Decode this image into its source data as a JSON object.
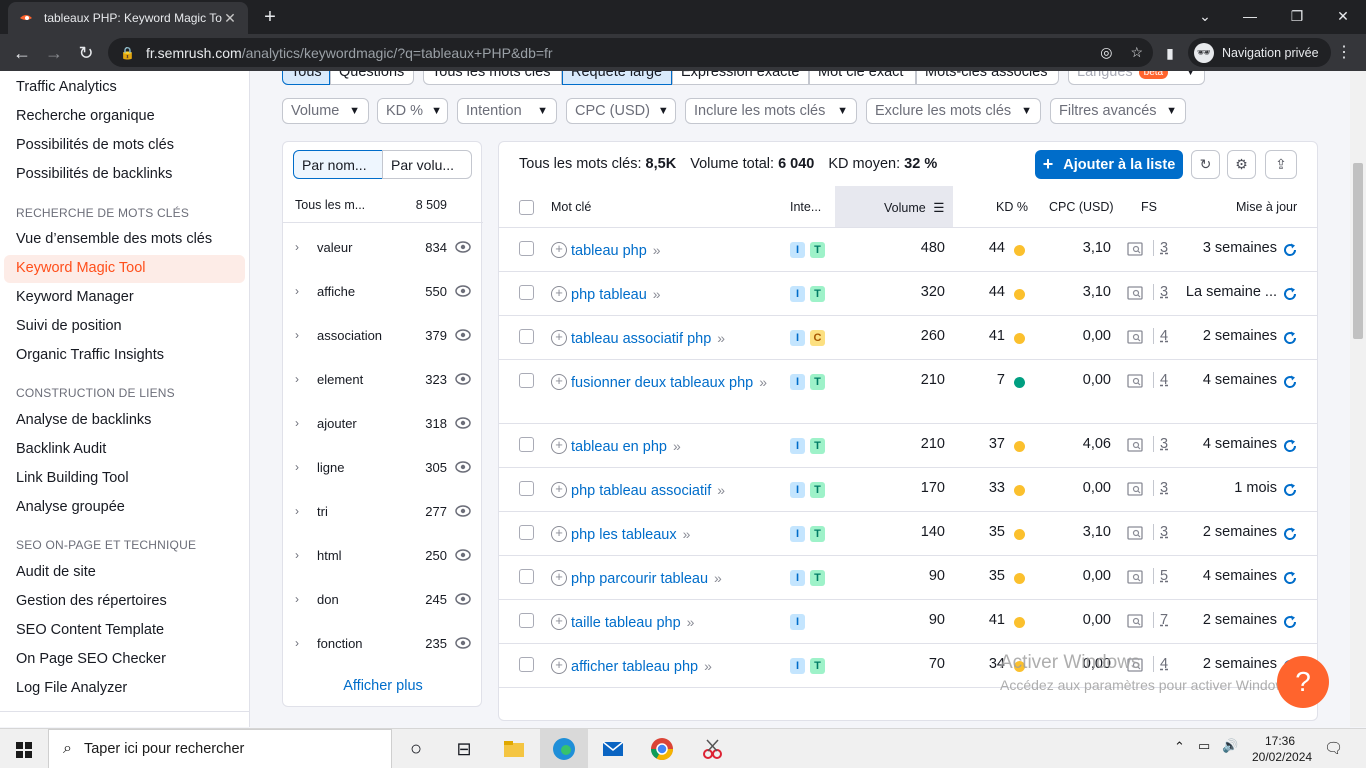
{
  "browser": {
    "tab_title": "tableaux PHP: Keyword Magic To",
    "url_host": "fr.semrush.com",
    "url_path": "/analytics/keywordmagic/?q=tableaux+PHP&db=fr",
    "incognito_label": "Navigation privée"
  },
  "sidebar": {
    "items_top": [
      "Traffic Analytics",
      "Recherche organique",
      "Possibilités de mots clés",
      "Possibilités de backlinks"
    ],
    "section1": "RECHERCHE DE MOTS CLÉS",
    "items1": [
      "Vue d’ensemble des mots clés",
      "Keyword Magic Tool",
      "Keyword Manager",
      "Suivi de position",
      "Organic Traffic Insights"
    ],
    "section2": "CONSTRUCTION DE LIENS",
    "items2": [
      "Analyse de backlinks",
      "Backlink Audit",
      "Link Building Tool",
      "Analyse groupée"
    ],
    "section3": "SEO ON-PAGE ET TECHNIQUE",
    "items3": [
      "Audit de site",
      "Gestion des répertoires",
      "SEO Content Template",
      "On Page SEO Checker",
      "Log File Analyzer"
    ]
  },
  "top_segments": [
    "Tous",
    "Questions",
    "Tous les mots clés",
    "Requête large",
    "Expression exacte",
    "Mot clé exact",
    "Mots-clés associés",
    "Langues",
    "beta"
  ],
  "filters": [
    "Volume",
    "KD %",
    "Intention",
    "CPC (USD)",
    "Inclure les mots clés",
    "Exclure les mots clés",
    "Filtres avancés"
  ],
  "groups": {
    "tab_by_name": "Par nom...",
    "tab_by_volume": "Par volu...",
    "header_label": "Tous les m...",
    "header_count": "8 509",
    "rows": [
      {
        "name": "valeur",
        "count": "834"
      },
      {
        "name": "affiche",
        "count": "550"
      },
      {
        "name": "association",
        "count": "379"
      },
      {
        "name": "element",
        "count": "323"
      },
      {
        "name": "ajouter",
        "count": "318"
      },
      {
        "name": "ligne",
        "count": "305"
      },
      {
        "name": "tri",
        "count": "277"
      },
      {
        "name": "html",
        "count": "250"
      },
      {
        "name": "don",
        "count": "245"
      },
      {
        "name": "fonction",
        "count": "235"
      }
    ],
    "more": "Afficher plus"
  },
  "summary": {
    "all_label": "Tous les mots clés:",
    "all_value": "8,5K",
    "vol_label": "Volume total:",
    "vol_value": "6 040",
    "kd_label": "KD moyen:",
    "kd_value": "32 %"
  },
  "add_button": "Ajouter à la liste",
  "columns": {
    "keyword": "Mot clé",
    "intent": "Inte...",
    "volume": "Volume",
    "kd": "KD %",
    "cpc": "CPC (USD)",
    "fs": "FS",
    "updated": "Mise à jour"
  },
  "rows": [
    {
      "kw": "tableau php",
      "intents": [
        "I",
        "T"
      ],
      "volume": "480",
      "kd": "44",
      "kd_color": "#fbc02d",
      "cpc": "3,10",
      "fs": "3",
      "updated": "3 semaines"
    },
    {
      "kw": "php tableau",
      "intents": [
        "I",
        "T"
      ],
      "volume": "320",
      "kd": "44",
      "kd_color": "#fbc02d",
      "cpc": "3,10",
      "fs": "3",
      "updated": "La semaine ..."
    },
    {
      "kw": "tableau associatif php",
      "intents": [
        "I",
        "C"
      ],
      "volume": "260",
      "kd": "41",
      "kd_color": "#fbc02d",
      "cpc": "0,00",
      "fs": "4",
      "updated": "2 semaines"
    },
    {
      "kw": "fusionner deux tableaux php",
      "intents": [
        "I",
        "T"
      ],
      "volume": "210",
      "kd": "7",
      "kd_color": "#009f81",
      "cpc": "0,00",
      "fs": "4",
      "updated": "4 semaines"
    },
    {
      "kw": "tableau en php",
      "intents": [
        "I",
        "T"
      ],
      "volume": "210",
      "kd": "37",
      "kd_color": "#fbc02d",
      "cpc": "4,06",
      "fs": "3",
      "updated": "4 semaines"
    },
    {
      "kw": "php tableau associatif",
      "intents": [
        "I",
        "T"
      ],
      "volume": "170",
      "kd": "33",
      "kd_color": "#fbc02d",
      "cpc": "0,00",
      "fs": "3",
      "updated": "1 mois"
    },
    {
      "kw": "php les tableaux",
      "intents": [
        "I",
        "T"
      ],
      "volume": "140",
      "kd": "35",
      "kd_color": "#fbc02d",
      "cpc": "3,10",
      "fs": "3",
      "updated": "2 semaines"
    },
    {
      "kw": "php parcourir tableau",
      "intents": [
        "I",
        "T"
      ],
      "volume": "90",
      "kd": "35",
      "kd_color": "#fbc02d",
      "cpc": "0,00",
      "fs": "5",
      "updated": "4 semaines"
    },
    {
      "kw": "taille tableau php",
      "intents": [
        "I"
      ],
      "volume": "90",
      "kd": "41",
      "kd_color": "#fbc02d",
      "cpc": "0,00",
      "fs": "7",
      "updated": "2 semaines"
    },
    {
      "kw": "afficher tableau php",
      "intents": [
        "I",
        "T"
      ],
      "volume": "70",
      "kd": "34",
      "kd_color": "#fbc02d",
      "cpc": "0,00",
      "fs": "4",
      "updated": "2 semaines"
    }
  ],
  "watermark": {
    "line1": "Activer Windows",
    "line2": "Accédez aux paramètres pour activer Windows."
  },
  "help_label": "?",
  "taskbar": {
    "search_placeholder": "Taper ici pour rechercher",
    "time": "17:36",
    "date": "20/02/2024"
  }
}
